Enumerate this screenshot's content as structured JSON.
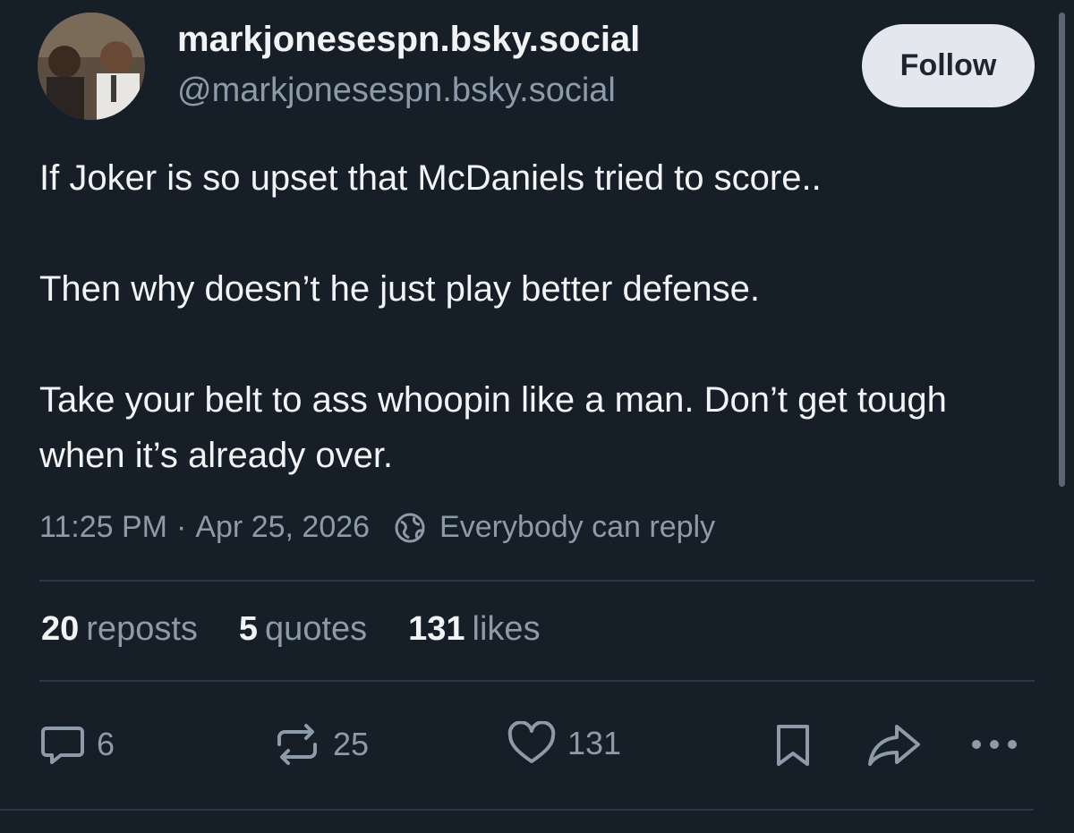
{
  "author": {
    "display_name": "markjonesespn.bsky.social",
    "handle": "@markjonesespn.bsky.social"
  },
  "follow_label": "Follow",
  "post": {
    "paragraphs": [
      "If Joker is so upset that McDaniels tried to score..",
      "Then why doesn’t he just play better defense.",
      "Take your belt to ass whoopin like a man. Don’t get tough when it’s already over."
    ],
    "time": "11:25 PM",
    "separator": "·",
    "date": "Apr 25, 2026",
    "reply_setting": "Everybody can reply"
  },
  "stats": {
    "reposts": {
      "count": "20",
      "label": "reposts"
    },
    "quotes": {
      "count": "5",
      "label": "quotes"
    },
    "likes": {
      "count": "131",
      "label": "likes"
    }
  },
  "actions": {
    "reply_count": "6",
    "repost_count": "25",
    "like_count": "131"
  },
  "icons": {
    "reply": "speech-bubble-icon",
    "repost": "repost-arrows-icon",
    "like": "heart-icon",
    "bookmark": "bookmark-icon",
    "share": "share-arrow-icon",
    "more": "ellipsis-icon",
    "reply_setting": "globe-icon"
  },
  "colors": {
    "background": "#161e27",
    "text": "#f1f3f5",
    "muted": "#8d9aaa",
    "follow_bg": "#e4e8ee"
  }
}
